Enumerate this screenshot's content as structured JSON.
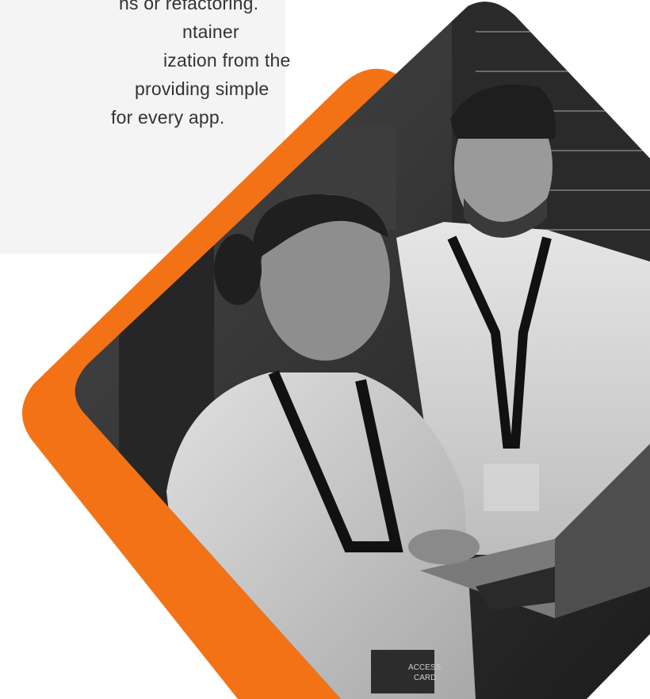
{
  "content": {
    "lines": [
      "ns or refactoring.",
      "ntainer",
      "ization from the",
      "providing simple",
      "for every app."
    ]
  },
  "colors": {
    "accent": "#F47216",
    "panel": "#f4f4f4",
    "text": "#333333"
  },
  "illustration": {
    "photo": "photo-two-people-server-room",
    "badge_text": [
      "ACCESS",
      "CARD"
    ]
  }
}
